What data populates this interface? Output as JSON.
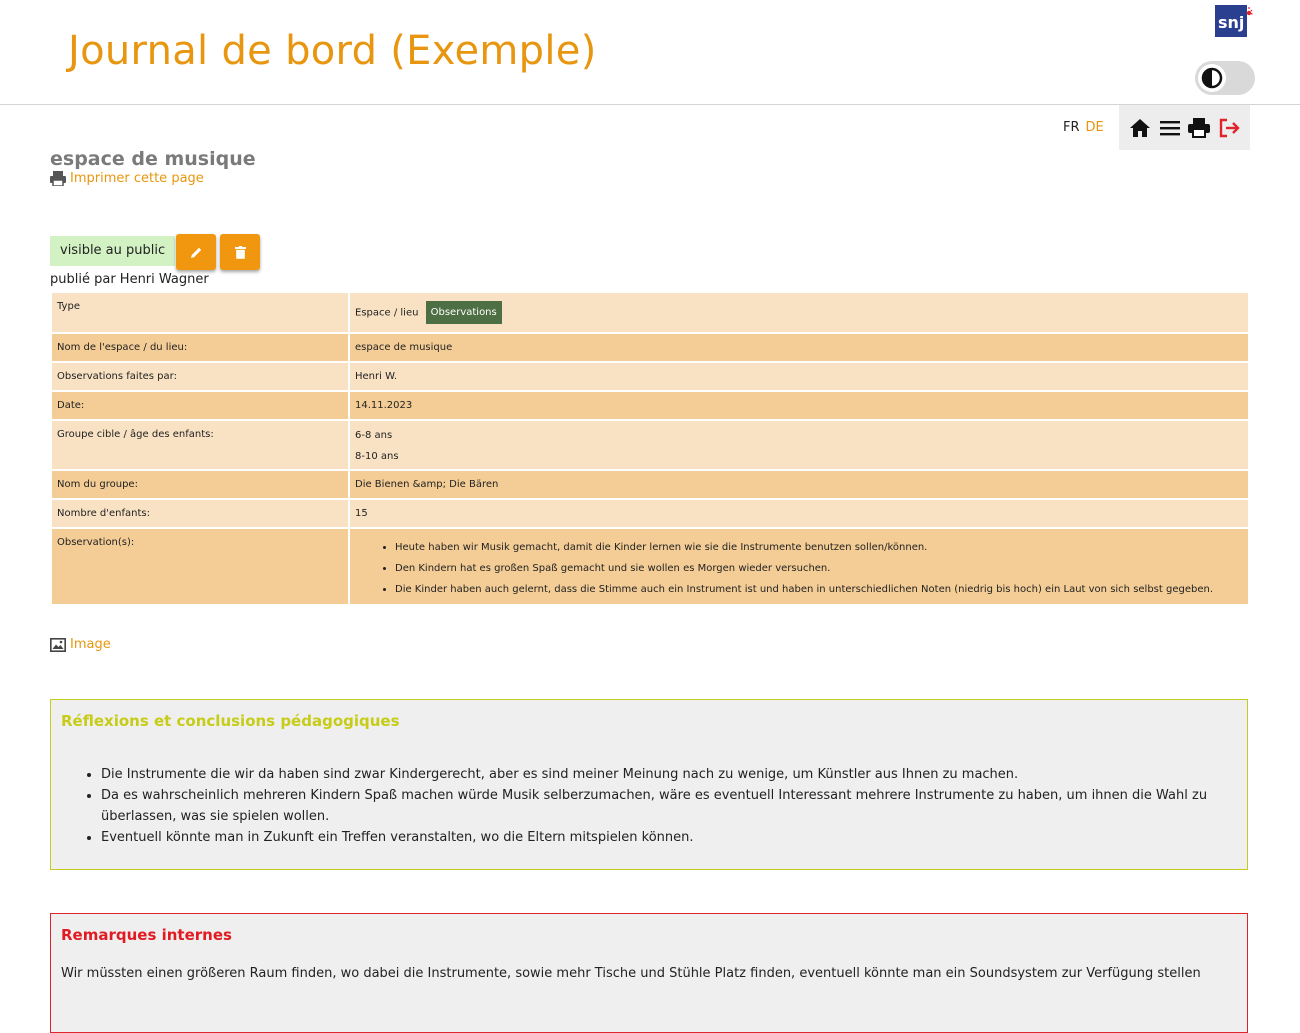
{
  "header": {
    "title": "Journal de bord (Exemple)",
    "logo_text": "snj"
  },
  "lang": {
    "fr": "FR",
    "de": "DE"
  },
  "toolbar": {
    "icons": [
      "home-icon",
      "menu-icon",
      "print-icon",
      "logout-icon"
    ]
  },
  "page": {
    "title": "espace de musique",
    "print_link": "Imprimer cette page",
    "visibility": "visible au public",
    "published_by": "publié par Henri Wagner",
    "image_link": "Image"
  },
  "details": {
    "type_label": "Type",
    "type_value": "Espace / lieu",
    "type_badge": "Observations",
    "rows": [
      {
        "label": "Nom de l'espace / du lieu:",
        "value": "espace de musique"
      },
      {
        "label": "Observations faites par:",
        "value": "Henri W."
      },
      {
        "label": "Date:",
        "value": "14.11.2023"
      }
    ],
    "age_label": "Groupe cible / âge des enfants:",
    "ages": [
      "6-8 ans",
      "8-10 ans"
    ],
    "group_label": "Nom du groupe:",
    "group_value": "Die Bienen &amp; Die Bären",
    "children_label": "Nombre d'enfants:",
    "children_value": "15",
    "observations_label": "Observation(s):",
    "observations": [
      "Heute haben wir Musik gemacht, damit die Kinder lernen wie sie die Instrumente benutzen sollen/können.",
      "Den Kindern hat es großen Spaß gemacht und sie wollen es Morgen wieder versuchen.",
      "Die Kinder haben auch gelernt, dass die Stimme auch ein Instrument ist und haben in unterschiedlichen Noten (niedrig bis hoch) ein Laut von sich selbst gegeben."
    ]
  },
  "reflection": {
    "title": "Réflexions et conclusions pédagogiques",
    "items": [
      "Die Instrumente die wir da haben sind zwar Kindergerecht, aber es sind meiner Meinung nach zu wenige, um Künstler aus Ihnen zu machen.",
      "Da es wahrscheinlich mehreren Kindern Spaß machen würde Musik selberzumachen, wäre es eventuell Interessant mehrere Instrumente zu haben, um ihnen die Wahl zu überlassen, was sie spielen wollen.",
      "Eventuell könnte man in Zukunft ein Treffen veranstalten, wo die Eltern mitspielen können."
    ]
  },
  "remarks": {
    "title": "Remarques internes",
    "text": "Wir müssten einen größeren Raum finden, wo dabei die Instrumente, sowie mehr Tische und Stühle Platz finden, eventuell könnte man ein Soundsystem zur Verfügung stellen"
  },
  "colors": {
    "accent": "#e8960f",
    "row_light": "#f9e2c4",
    "row_dark": "#f4cd96",
    "badge_green": "#4e6f44",
    "reflect_border": "#c4cd1f",
    "remarks_red": "#e01b22"
  }
}
